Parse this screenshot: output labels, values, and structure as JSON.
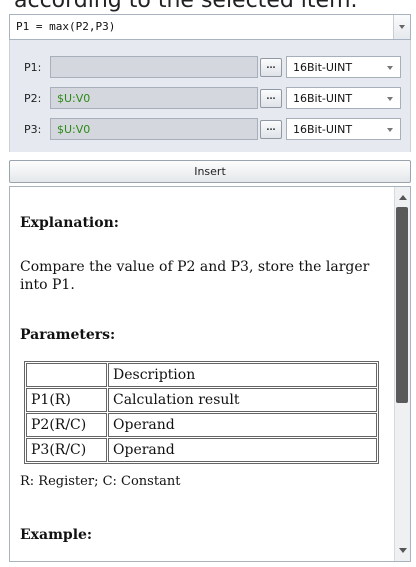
{
  "cutoff_text": "according to the selected item.",
  "formula": {
    "text": "P1 = max(P2,P3)"
  },
  "params": [
    {
      "label": "P1:",
      "value": "",
      "dots": "...",
      "type": "16Bit-UINT"
    },
    {
      "label": "P2:",
      "value": "$U:V0",
      "dots": "...",
      "type": "16Bit-UINT"
    },
    {
      "label": "P3:",
      "value": "$U:V0",
      "dots": "...",
      "type": "16Bit-UINT"
    }
  ],
  "insert_label": "Insert",
  "doc": {
    "explanation_heading": "Explanation:",
    "explanation_text": "Compare the value of P2 and P3, store the larger into P1.",
    "parameters_heading": "Parameters:",
    "table": {
      "header": [
        "",
        "Description"
      ],
      "rows": [
        [
          "P1(R)",
          "Calculation result"
        ],
        [
          "P2(R/C)",
          "Operand"
        ],
        [
          "P3(R/C)",
          "Operand"
        ]
      ]
    },
    "legend": "R: Register; C: Constant",
    "example_heading": "Example:"
  },
  "colors": {
    "value_text": "#2c8a16",
    "panel_bg": "#e6eaf0",
    "scroll_thumb": "#5a5a5a"
  }
}
